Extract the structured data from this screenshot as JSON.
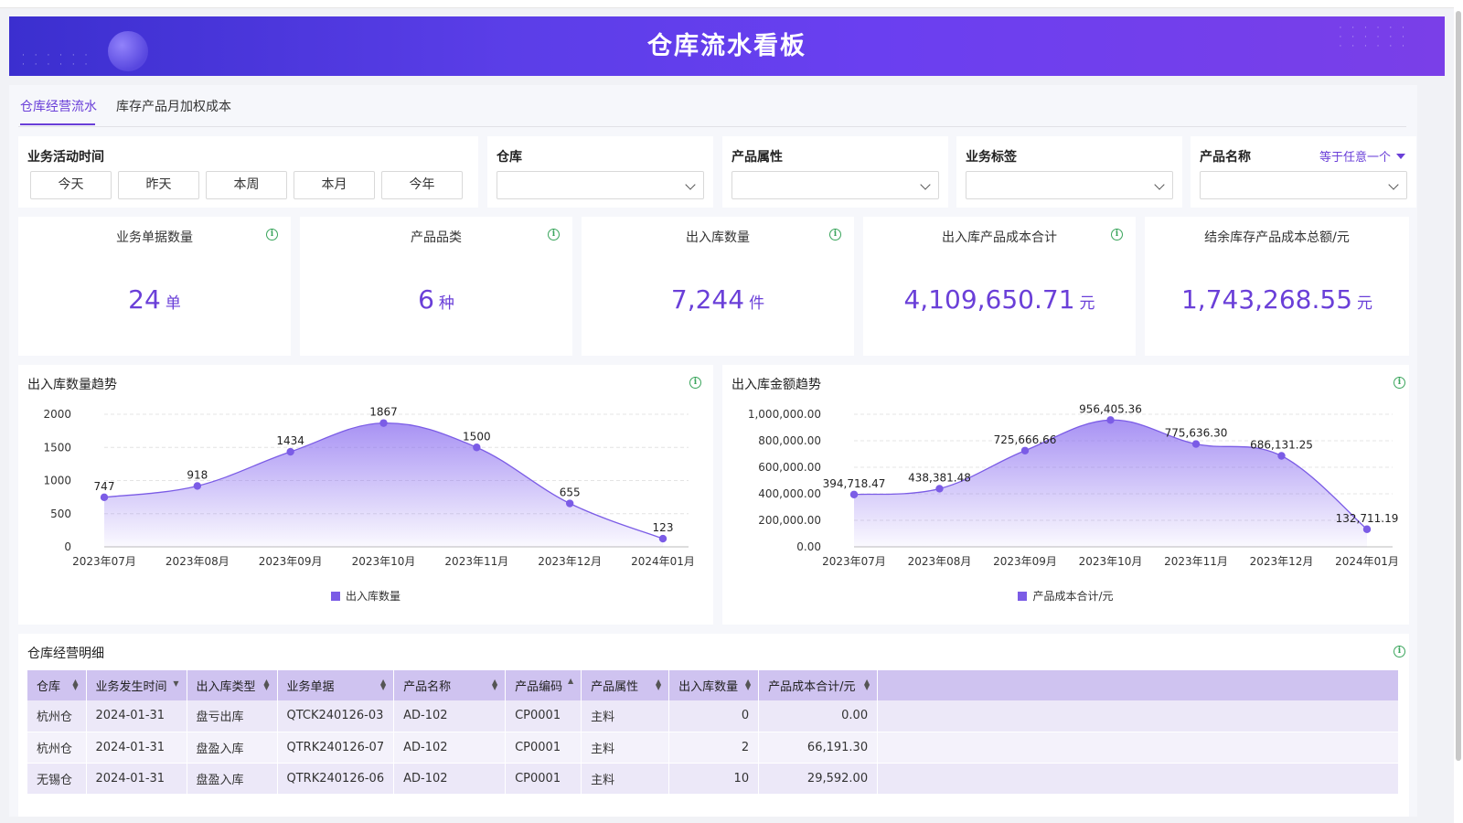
{
  "app": {
    "title": "仓库流水看板"
  },
  "tabs": [
    {
      "label": "仓库经营流水",
      "active": true
    },
    {
      "label": "库存产品月加权成本",
      "active": false
    }
  ],
  "filters": {
    "time": {
      "label": "业务活动时间",
      "buttons": [
        "今天",
        "昨天",
        "本周",
        "本月",
        "今年"
      ]
    },
    "warehouse": {
      "label": "仓库",
      "value": ""
    },
    "product_attr": {
      "label": "产品属性",
      "value": ""
    },
    "biz_tag": {
      "label": "业务标签",
      "value": ""
    },
    "product_name": {
      "label": "产品名称",
      "mode": "等于任意一个",
      "value": ""
    }
  },
  "kpis": [
    {
      "title": "业务单据数量",
      "value": "24",
      "unit": "单"
    },
    {
      "title": "产品品类",
      "value": "6",
      "unit": "种"
    },
    {
      "title": "出入库数量",
      "value": "7,244",
      "unit": "件"
    },
    {
      "title": "出入库产品成本合计",
      "value": "4,109,650.71",
      "unit": "元"
    },
    {
      "title": "结余库存产品成本总额/元",
      "value": "1,743,268.55",
      "unit": "元"
    }
  ],
  "colors": {
    "accent": "#6a3fd8",
    "series": "#7b5ce6",
    "info": "#3aa55c"
  },
  "chart_data": [
    {
      "type": "area",
      "title": "出入库数量趋势",
      "categories": [
        "2023年07月",
        "2023年08月",
        "2023年09月",
        "2023年10月",
        "2023年11月",
        "2023年12月",
        "2024年01月"
      ],
      "series": [
        {
          "name": "出入库数量",
          "values": [
            747,
            918,
            1434,
            1867,
            1500,
            655,
            123
          ]
        }
      ],
      "labels": [
        "747",
        "918",
        "1434",
        "1867",
        "1500",
        "655",
        "123"
      ],
      "yticks": [
        "0",
        "500",
        "1000",
        "1500",
        "2000"
      ],
      "ylim": [
        0,
        2000
      ],
      "grid": true,
      "legend": "bottom"
    },
    {
      "type": "area",
      "title": "出入库金额趋势",
      "categories": [
        "2023年07月",
        "2023年08月",
        "2023年09月",
        "2023年10月",
        "2023年11月",
        "2023年12月",
        "2024年01月"
      ],
      "series": [
        {
          "name": "产品成本合计/元",
          "values": [
            394718.47,
            438381.48,
            725666.66,
            956405.36,
            775636.3,
            686131.25,
            132711.19
          ]
        }
      ],
      "labels": [
        "394,718.47",
        "438,381.48",
        "725,666.66",
        "956,405.36",
        "775,636.30",
        "686,131.25",
        "132,711.19"
      ],
      "yticks": [
        "0.00",
        "200,000.00",
        "400,000.00",
        "600,000.00",
        "800,000.00",
        "1,000,000.00"
      ],
      "ylim": [
        0,
        1000000
      ],
      "grid": true,
      "legend": "bottom"
    }
  ],
  "table": {
    "title": "仓库经营明细",
    "columns": [
      "仓库",
      "业务发生时间",
      "出入库类型",
      "业务单据",
      "产品名称",
      "产品编码",
      "产品属性",
      "出入库数量",
      "产品成本合计/元"
    ],
    "rows": [
      [
        "杭州仓",
        "2024-01-31",
        "盘亏出库",
        "QTCK240126-03",
        "AD-102",
        "CP0001",
        "主料",
        "0",
        "0.00"
      ],
      [
        "杭州仓",
        "2024-01-31",
        "盘盈入库",
        "QTRK240126-07",
        "AD-102",
        "CP0001",
        "主料",
        "2",
        "66,191.30"
      ],
      [
        "无锡仓",
        "2024-01-31",
        "盘盈入库",
        "QTRK240126-06",
        "AD-102",
        "CP0001",
        "主料",
        "10",
        "29,592.00"
      ]
    ]
  }
}
